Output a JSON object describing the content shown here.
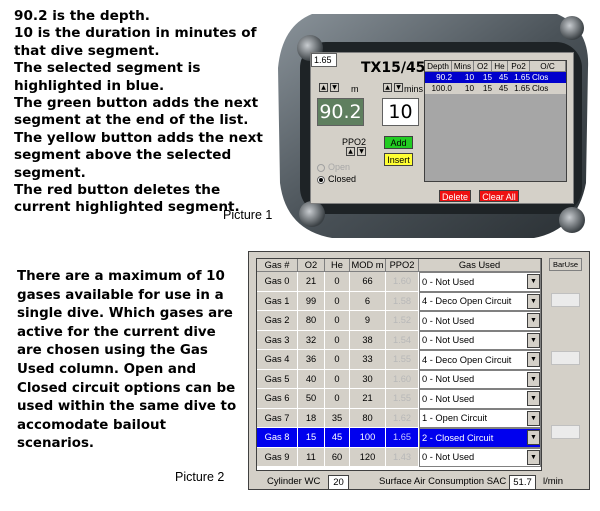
{
  "description": {
    "para1": "90.2 is the depth.\n10 is the duration in minutes of that dive segment.\nThe selected segment is highlighted in blue.\nThe green button adds the next segment at the end of the list.\nThe yellow button adds the next segment above the selected segment.\nThe red button deletes the current highlighted segment.",
    "para2": "There are a maximum of 10 gases available for use in a single dive. Which gases are active for the current dive are chosen using the Gas Used column. Open and Closed circuit options can be used within the same dive to accomodate bailout scenarios."
  },
  "labels": {
    "picture1": "Picture 1",
    "picture2": "Picture 2"
  },
  "device": {
    "model": "TX15/45",
    "depth_unit": "m",
    "mins_unit": "mins",
    "depth_value": "90.2",
    "mins_value": "10",
    "ppo2_label": "PPO2",
    "ppo2_value": "1.65",
    "add_label": "Add",
    "insert_label": "Insert",
    "open_label": "Open",
    "closed_label": "Closed",
    "delete_label": "Delete",
    "clear_all_label": "Clear All",
    "segments": {
      "headers": [
        "Depth",
        "Mins",
        "O2",
        "He",
        "Po2",
        "O/C"
      ],
      "rows": [
        {
          "cells": [
            "90.2",
            "10",
            "15",
            "45",
            "1.65",
            "Clos"
          ],
          "selected": true
        },
        {
          "cells": [
            "100.0",
            "10",
            "15",
            "45",
            "1.65",
            "Clos"
          ],
          "selected": false
        }
      ]
    },
    "colors": {
      "selected": "#0000cc",
      "add": "#22cc22",
      "insert": "#ffff33",
      "delete": "#ee1111"
    }
  },
  "gas_table": {
    "headers": [
      "Gas #",
      "O2",
      "He",
      "MOD m",
      "PPO2",
      "Gas Used"
    ],
    "bar_use_header": "BarUse",
    "rows": [
      {
        "gas": "Gas 0",
        "o2": "21",
        "he": "0",
        "mod": "66",
        "ppo2": "1.60",
        "used": "0 - Not Used",
        "selected": false
      },
      {
        "gas": "Gas 1",
        "o2": "99",
        "he": "0",
        "mod": "6",
        "ppo2": "1.58",
        "used": "4 - Deco Open Circuit",
        "selected": false
      },
      {
        "gas": "Gas 2",
        "o2": "80",
        "he": "0",
        "mod": "9",
        "ppo2": "1.52",
        "used": "0 - Not Used",
        "selected": false
      },
      {
        "gas": "Gas 3",
        "o2": "32",
        "he": "0",
        "mod": "38",
        "ppo2": "1.54",
        "used": "0 - Not Used",
        "selected": false
      },
      {
        "gas": "Gas 4",
        "o2": "36",
        "he": "0",
        "mod": "33",
        "ppo2": "1.55",
        "used": "4 - Deco Open Circuit",
        "selected": false
      },
      {
        "gas": "Gas 5",
        "o2": "40",
        "he": "0",
        "mod": "30",
        "ppo2": "1.60",
        "used": "0 - Not Used",
        "selected": false
      },
      {
        "gas": "Gas 6",
        "o2": "50",
        "he": "0",
        "mod": "21",
        "ppo2": "1.55",
        "used": "0 - Not Used",
        "selected": false
      },
      {
        "gas": "Gas 7",
        "o2": "18",
        "he": "35",
        "mod": "80",
        "ppo2": "1.62",
        "used": "1 - Open Circuit",
        "selected": false
      },
      {
        "gas": "Gas 8",
        "o2": "15",
        "he": "45",
        "mod": "100",
        "ppo2": "1.65",
        "used": "2 - Closed Circuit",
        "selected": true
      },
      {
        "gas": "Gas 9",
        "o2": "11",
        "he": "60",
        "mod": "120",
        "ppo2": "1.43",
        "used": "0 - Not Used",
        "selected": false
      }
    ],
    "cylinder_label": "Cylinder WC",
    "cylinder_value": "20",
    "sac_label": "Surface Air Consumption SAC",
    "sac_value": "51.7",
    "sac_unit": "l/min"
  }
}
